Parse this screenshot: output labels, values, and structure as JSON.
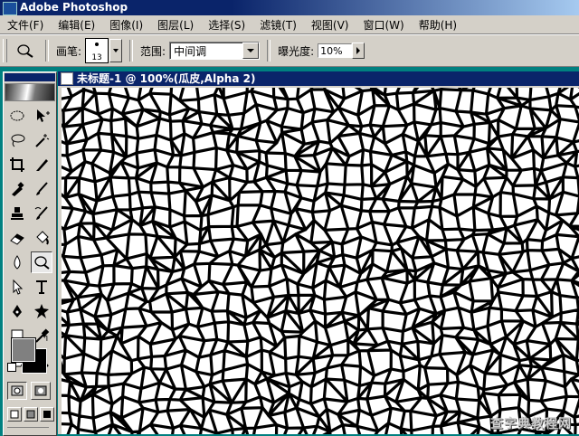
{
  "app": {
    "title": "Adobe Photoshop"
  },
  "menu": [
    "文件(F)",
    "编辑(E)",
    "图像(I)",
    "图层(L)",
    "选择(S)",
    "滤镜(T)",
    "视图(V)",
    "窗口(W)",
    "帮助(H)"
  ],
  "options": {
    "tool_icon": "dodge-tool-icon",
    "brush_label": "画笔:",
    "brush_size": "13",
    "range_label": "范围:",
    "range_value": "中间调",
    "exposure_label": "曝光度:",
    "exposure_value": "10%"
  },
  "toolbox": {
    "tools": [
      "marquee-tool-icon",
      "move-tool-icon",
      "lasso-tool-icon",
      "magic-wand-icon",
      "crop-tool-icon",
      "slice-tool-icon",
      "healing-brush-icon",
      "brush-tool-icon",
      "clone-stamp-icon",
      "history-brush-icon",
      "eraser-icon",
      "paint-bucket-icon",
      "blur-tool-icon",
      "dodge-tool-icon",
      "path-select-icon",
      "type-tool-icon",
      "pen-tool-icon",
      "shape-tool-icon",
      "notes-tool-icon",
      "eyedropper-icon",
      "hand-tool-icon",
      "zoom-tool-icon"
    ],
    "active_tool": "dodge-tool-icon",
    "foreground_color": "#808080",
    "background_color": "#000000"
  },
  "document": {
    "title": "未标题-1 @ 100%(瓜皮,Alpha 2)",
    "zoom": "100%"
  },
  "watermark": "查字典教程网"
}
